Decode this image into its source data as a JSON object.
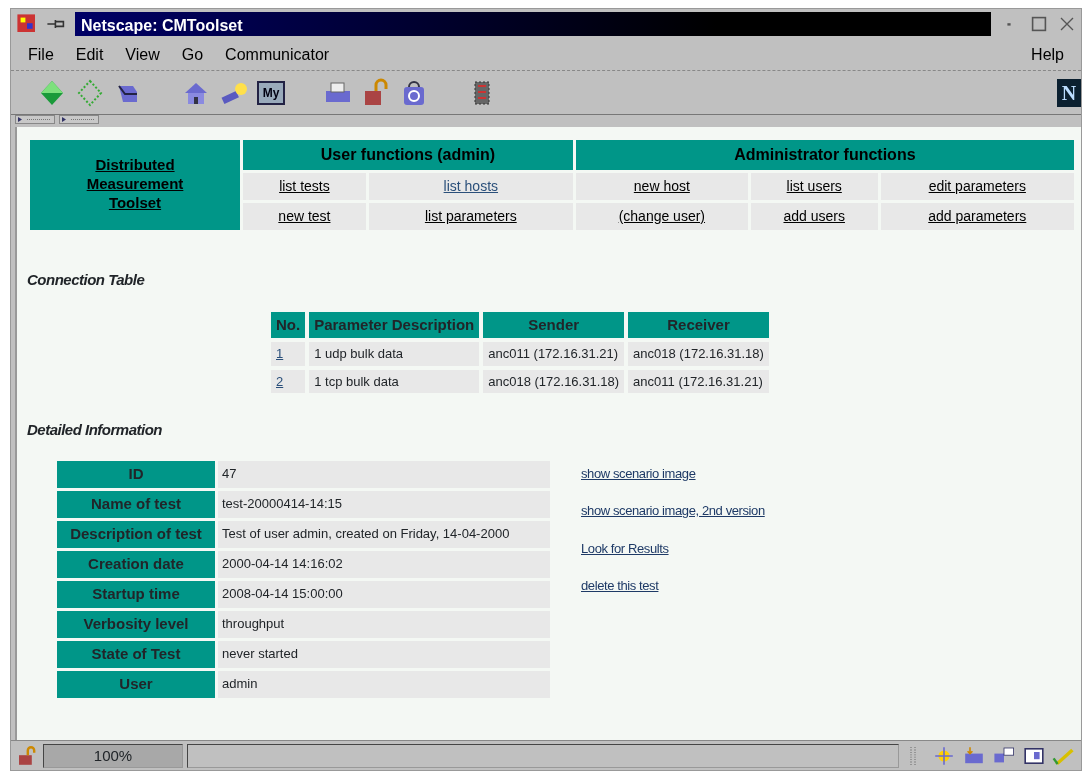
{
  "window": {
    "title": "Netscape: CMToolset"
  },
  "menu": [
    {
      "label": "File"
    },
    {
      "label": "Edit"
    },
    {
      "label": "View"
    },
    {
      "label": "Go"
    },
    {
      "label": "Communicator"
    }
  ],
  "help_menu": "Help",
  "toolbar": {
    "my_label": "My",
    "brand_letter": "N"
  },
  "nav": {
    "title": "Distributed Measurement Toolset",
    "sections": [
      {
        "title": "User functions (admin)",
        "rows": [
          [
            {
              "label": "list tests",
              "visited": false
            },
            {
              "label": "list hosts",
              "visited": true
            }
          ],
          [
            {
              "label": "new test",
              "visited": false
            },
            {
              "label": "list parameters",
              "visited": false
            }
          ]
        ]
      },
      {
        "title": "Administrator functions",
        "rows": [
          [
            {
              "label": "new host",
              "visited": false
            },
            {
              "label": "list users",
              "visited": false
            },
            {
              "label": "edit parameters",
              "visited": false
            }
          ],
          [
            {
              "label": "(change user)",
              "visited": false
            },
            {
              "label": "add users",
              "visited": false
            },
            {
              "label": "add parameters",
              "visited": false
            }
          ]
        ]
      }
    ]
  },
  "connection_table": {
    "heading": "Connection Table",
    "columns": [
      "No.",
      "Parameter Description",
      "Sender",
      "Receiver"
    ],
    "rows": [
      {
        "no": "1",
        "description": "1 udp bulk data",
        "sender": "anc011 (172.16.31.21)",
        "receiver": "anc018 (172.16.31.18)"
      },
      {
        "no": "2",
        "description": "1 tcp bulk data",
        "sender": "anc018 (172.16.31.18)",
        "receiver": "anc011 (172.16.31.21)"
      }
    ]
  },
  "details": {
    "heading": "Detailed Information",
    "rows": [
      {
        "label": "ID",
        "value": "47"
      },
      {
        "label": "Name of test",
        "value": "test-20000414-14:15"
      },
      {
        "label": "Description of test",
        "value": "Test of user admin, created on Friday, 14-04-2000"
      },
      {
        "label": "Creation date",
        "value": "2000-04-14 14:16:02"
      },
      {
        "label": "Startup time",
        "value": "2008-04-14 15:00:00"
      },
      {
        "label": "Verbosity level",
        "value": "throughput"
      },
      {
        "label": "State of Test",
        "value": "never started"
      },
      {
        "label": "User",
        "value": "admin"
      }
    ],
    "links": [
      "show scenario image",
      "show scenario image, 2nd version",
      "Look for Results",
      "delete this test"
    ]
  },
  "status_bar": {
    "zoom": "100%"
  }
}
